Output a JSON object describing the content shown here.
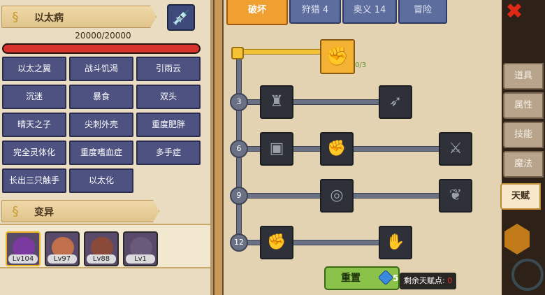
{
  "left": {
    "disease_title": "以太病",
    "hp_text": "20000/20000",
    "hp_fraction": 1.0,
    "skills": [
      "以太之翼",
      "战斗饥渴",
      "引雨云",
      "沉迷",
      "暴食",
      "双头",
      "晴天之子",
      "尖刺外壳",
      "重度肥胖",
      "完全灵体化",
      "重度嗜血症",
      "多手症",
      "长出三只触手",
      "以太化"
    ],
    "mutation_title": "变异",
    "characters": [
      {
        "level": "Lv104",
        "color": "#7a3aa0"
      },
      {
        "level": "Lv97",
        "color": "#c0704a"
      },
      {
        "level": "Lv88",
        "color": "#8a4a3a"
      },
      {
        "level": "Lv1",
        "color": "#6a5a7a"
      }
    ]
  },
  "tabs": [
    "破坏",
    "狩猎 4",
    "奥义 14",
    "冒险"
  ],
  "tree": {
    "levels": [
      "3",
      "6",
      "9",
      "12"
    ],
    "top_count": "0/3",
    "reset_label": "重置",
    "reset_cost": "5",
    "points_label": "剩余天赋点:",
    "points_value": "0"
  },
  "sidebar": {
    "close": "✖",
    "tabs": [
      "道具",
      "属性",
      "技能",
      "魔法",
      "天赋"
    ]
  },
  "colors": {
    "accent": "#f0a030",
    "skill_bg": "#4d5280",
    "hp": "#d8322c"
  }
}
